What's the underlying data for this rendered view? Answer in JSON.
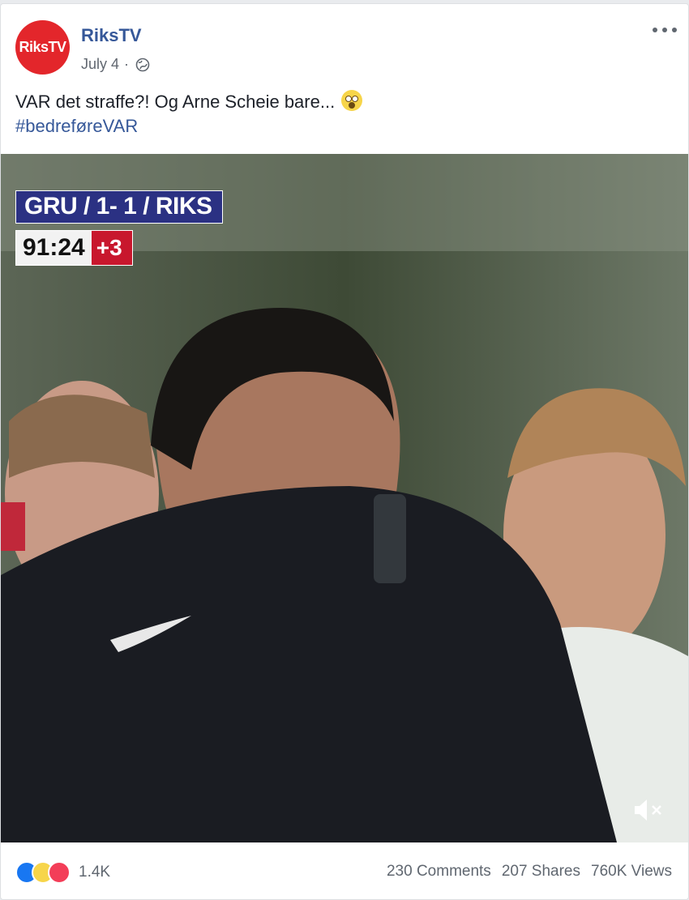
{
  "post": {
    "page_name": "RiksTV",
    "avatar_text": "RiksTV",
    "date": "July 4",
    "date_separator": "·",
    "privacy_icon": "globe-icon",
    "more_icon": "more-options-icon",
    "text": "VAR det straffe?! Og Arne Scheie bare...",
    "text_emoji": "screaming-in-fear-emoji",
    "hashtag": "#bedreføreVAR"
  },
  "video": {
    "scoreboard": "GRU / 1- 1 / RIKS",
    "match_time": "91:24",
    "added_time": "+3",
    "mute_icon": "volume-muted-icon"
  },
  "footer": {
    "reaction_icons": [
      "like-reaction-icon",
      "haha-reaction-icon",
      "love-reaction-icon"
    ],
    "reaction_count": "1.4K",
    "comments": "230 Comments",
    "shares": "207 Shares",
    "views": "760K Views"
  },
  "colors": {
    "link": "#365899",
    "brand_red": "#e3262b",
    "scoreboard_bg": "#2b3183",
    "added_time_bg": "#c8172d"
  }
}
